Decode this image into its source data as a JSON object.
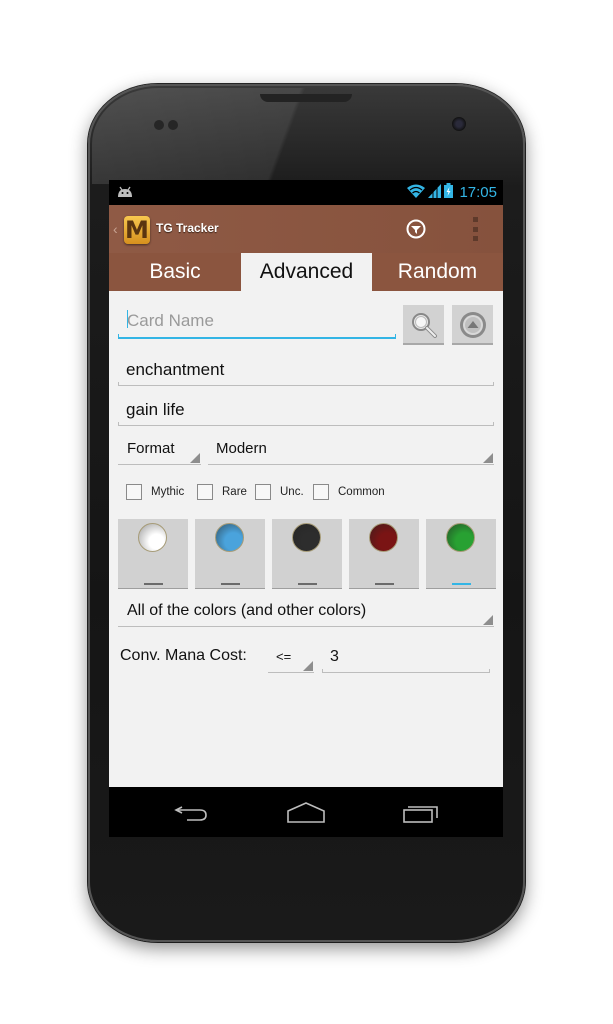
{
  "status_bar": {
    "notification_icon": "android-icon",
    "icons": [
      "wifi-icon",
      "signal-icon",
      "battery-charging-icon"
    ],
    "time": "17:05"
  },
  "action_bar": {
    "logo_letter": "M",
    "title": "TG Tracker",
    "up_glyph": "‹",
    "actions": [
      "filter-icon",
      "overflow-menu-icon"
    ]
  },
  "tabs": [
    {
      "label": "Basic",
      "selected": false
    },
    {
      "label": "Advanced",
      "selected": true
    },
    {
      "label": "Random",
      "selected": false
    }
  ],
  "form": {
    "card_name": {
      "value": "",
      "placeholder": "Card Name"
    },
    "search_button": "search-icon",
    "collapse_button": "collapse-up-icon",
    "type_field": {
      "value": "enchantment"
    },
    "text_field": {
      "value": "gain life"
    },
    "format_label": "Format",
    "format_value": "Modern",
    "rarities": [
      {
        "label": "Mythic",
        "checked": false
      },
      {
        "label": "Rare",
        "checked": false
      },
      {
        "label": "Unc.",
        "checked": false
      },
      {
        "label": "Common",
        "checked": false
      }
    ],
    "colors": [
      {
        "name": "White",
        "hex": "#f4f4f4",
        "selected": false
      },
      {
        "name": "Blue",
        "hex": "#4aa3dc",
        "selected": false
      },
      {
        "name": "Black",
        "hex": "#2d2d2d",
        "selected": false
      },
      {
        "name": "Red",
        "hex": "#7a1414",
        "selected": false
      },
      {
        "name": "Green",
        "hex": "#28a132",
        "selected": true
      }
    ],
    "color_mode": "All of the colors (and other colors)",
    "cmc_label": "Conv. Mana Cost:",
    "cmc_operator": "<=",
    "cmc_value": "3"
  },
  "nav_bar": [
    "back-icon",
    "home-icon",
    "recent-apps-icon"
  ],
  "colors": {
    "action_bar": "#8b553f",
    "accent": "#33b5e5",
    "background": "#f2f2f2"
  }
}
